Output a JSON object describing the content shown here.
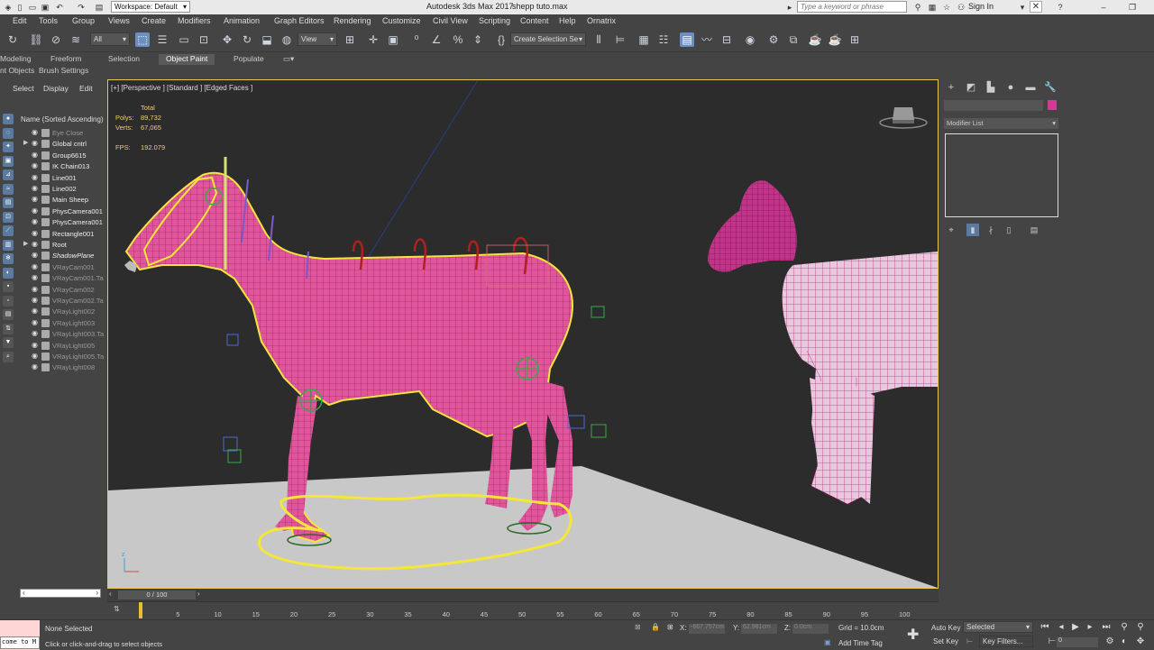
{
  "title": {
    "app": "Autodesk 3ds Max 2017",
    "file": "shepp tuto.max",
    "workspace": "Workspace: Default",
    "search_placeholder": "Type a keyword or phrase",
    "sign_in": "Sign In"
  },
  "menu": [
    "Edit",
    "Tools",
    "Group",
    "Views",
    "Create",
    "Modifiers",
    "Animation",
    "Graph Editors",
    "Rendering",
    "Customize",
    "Civil View",
    "Scripting",
    "Content",
    "Help",
    "Ornatrix"
  ],
  "toolbar": {
    "filter_value": "All",
    "view_value": "View",
    "selection_set_placeholder": "Create Selection Se"
  },
  "ribbon": {
    "tabs": [
      "Modeling",
      "Freeform",
      "Selection",
      "Object Paint",
      "Populate"
    ],
    "active_tab": "Object Paint",
    "sub_tabs": [
      "nt Objects",
      "Brush Settings"
    ]
  },
  "explorer": {
    "tabs": [
      "Select",
      "Display",
      "Edit"
    ],
    "column_header": "Name (Sorted Ascending)",
    "items": [
      {
        "label": "Eye Close",
        "dim": true
      },
      {
        "label": "Global cntrl",
        "arrow": true
      },
      {
        "label": "Group6615"
      },
      {
        "label": "IK Chain013"
      },
      {
        "label": "Line001"
      },
      {
        "label": "Line002"
      },
      {
        "label": "Main Sheep"
      },
      {
        "label": "PhysCamera001"
      },
      {
        "label": "PhysCamera001"
      },
      {
        "label": "Rectangle001"
      },
      {
        "label": "Root",
        "arrow": true
      },
      {
        "label": "ShadowPlane",
        "italic": true
      },
      {
        "label": "VRayCam001",
        "dim": true
      },
      {
        "label": "VRayCam001.Ta",
        "dim": true
      },
      {
        "label": "VRayCam002",
        "dim": true
      },
      {
        "label": "VRayCam002.Ta",
        "dim": true
      },
      {
        "label": "VRayLight002",
        "dim": true
      },
      {
        "label": "VRayLight003",
        "dim": true
      },
      {
        "label": "VRayLight003.Ta",
        "dim": true
      },
      {
        "label": "VRayLight005",
        "dim": true
      },
      {
        "label": "VRayLight005.Ta",
        "dim": true
      },
      {
        "label": "VRayLight008",
        "dim": true
      }
    ]
  },
  "viewport": {
    "label": "[+] [Perspective ] [Standard ] [Edged Faces ]",
    "stats": {
      "total_label": "Total",
      "polys_label": "Polys:",
      "polys_value": "89,732",
      "verts_label": "Verts:",
      "verts_value": "67,065",
      "fps_label": "FPS:",
      "fps_value": "192.079"
    }
  },
  "command_panel": {
    "modifier_list": "Modifier List",
    "object_color": "#d43a92"
  },
  "timeline": {
    "frame_display": "0 / 100",
    "ticks": [
      "0",
      "5",
      "10",
      "15",
      "20",
      "25",
      "30",
      "35",
      "40",
      "45",
      "50",
      "55",
      "60",
      "65",
      "70",
      "75",
      "80",
      "85",
      "90",
      "95",
      "100"
    ]
  },
  "status": {
    "maxscript_text": "come to M",
    "selection": "None Selected",
    "prompt": "Click or click-and-drag to select objects",
    "x_label": "X:",
    "x_value": "-667.757cm",
    "y_label": "Y:",
    "y_value": "62.981cm",
    "z_label": "Z:",
    "z_value": "0.0cm",
    "grid": "Grid = 10.0cm",
    "add_time_tag": "Add Time Tag",
    "auto_key": "Auto Key",
    "set_key": "Set Key",
    "selected_value": "Selected",
    "key_filters": "Key Filters...",
    "frame_value": "0"
  },
  "colors": {
    "sheep_pink": "#e0559b",
    "selection_yellow": "#f5e63a",
    "helper_green": "#3aa84a"
  }
}
